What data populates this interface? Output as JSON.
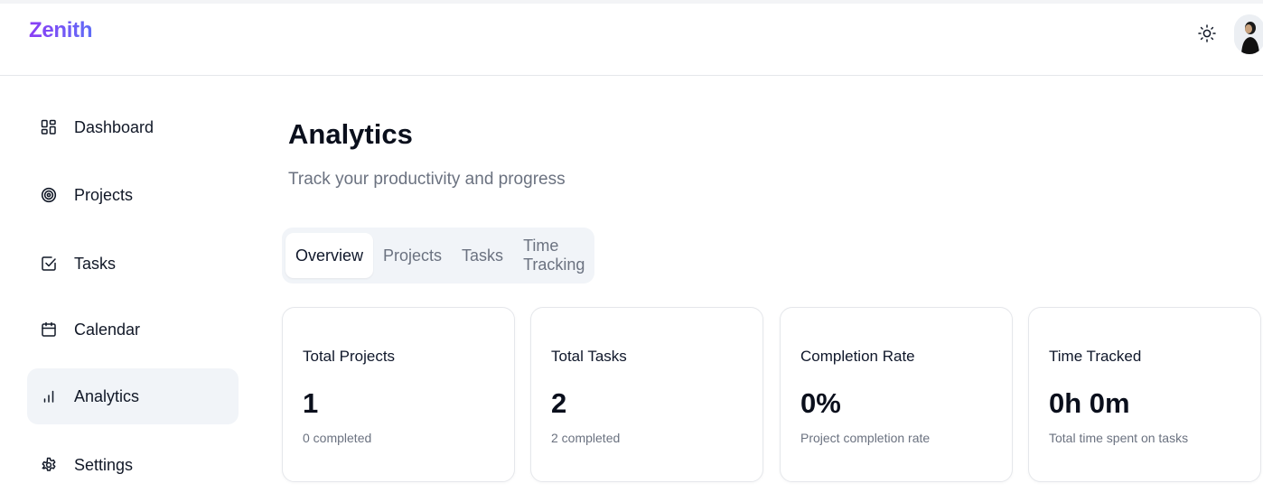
{
  "app": {
    "name": "Zenith"
  },
  "header": {
    "theme_icon": "sun-icon",
    "avatar_icon": "user-avatar"
  },
  "sidebar": {
    "items": [
      {
        "label": "Dashboard",
        "icon": "dashboard-icon",
        "active": false
      },
      {
        "label": "Projects",
        "icon": "target-icon",
        "active": false
      },
      {
        "label": "Tasks",
        "icon": "checkbox-icon",
        "active": false
      },
      {
        "label": "Calendar",
        "icon": "calendar-icon",
        "active": false
      },
      {
        "label": "Analytics",
        "icon": "bar-chart-icon",
        "active": true
      },
      {
        "label": "Settings",
        "icon": "gear-icon",
        "active": false
      }
    ]
  },
  "main": {
    "title": "Analytics",
    "subtitle": "Track your productivity and progress",
    "tabs": [
      {
        "label": "Overview",
        "active": true
      },
      {
        "label": "Projects",
        "active": false
      },
      {
        "label": "Tasks",
        "active": false
      },
      {
        "label": "Time Tracking",
        "active": false
      }
    ],
    "cards": [
      {
        "title": "Total Projects",
        "value": "1",
        "sub": "0 completed"
      },
      {
        "title": "Total Tasks",
        "value": "2",
        "sub": "2 completed"
      },
      {
        "title": "Completion Rate",
        "value": "0%",
        "sub": "Project completion rate"
      },
      {
        "title": "Time Tracked",
        "value": "0h 0m",
        "sub": "Total time spent on tasks"
      }
    ]
  },
  "colors": {
    "brand_gradient_start": "#8b3df5",
    "brand_gradient_end": "#5f6cf6",
    "active_nav_bg": "#f1f4f8",
    "muted_text": "#6b7280"
  }
}
